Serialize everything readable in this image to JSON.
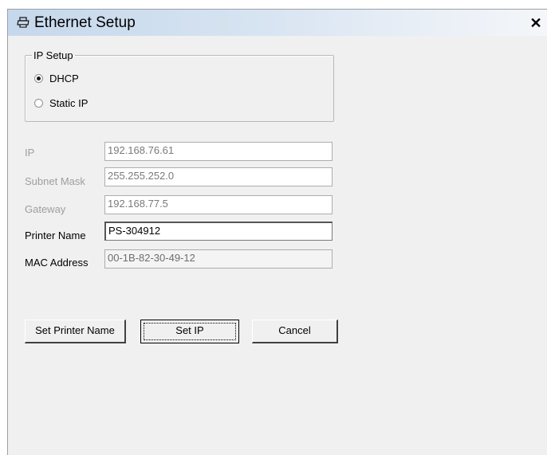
{
  "window": {
    "title": "Ethernet Setup",
    "title_icon": "printer-icon",
    "close_glyph": "✕"
  },
  "ip_setup": {
    "legend": "IP Setup",
    "options": [
      {
        "label": "DHCP",
        "selected": true
      },
      {
        "label": "Static IP",
        "selected": false
      }
    ]
  },
  "fields": {
    "ip": {
      "label": "IP",
      "value": "192.168.76.61",
      "enabled": false
    },
    "subnet_mask": {
      "label": "Subnet Mask",
      "value": "255.255.252.0",
      "enabled": false
    },
    "gateway": {
      "label": "Gateway",
      "value": "192.168.77.5",
      "enabled": false
    },
    "printer_name": {
      "label": "Printer Name",
      "value": "PS-304912",
      "enabled": true
    },
    "mac_address": {
      "label": "MAC Address",
      "value": "00-1B-82-30-49-12",
      "enabled": false
    }
  },
  "buttons": {
    "set_printer_name": "Set Printer Name",
    "set_ip": "Set IP",
    "cancel": "Cancel"
  }
}
